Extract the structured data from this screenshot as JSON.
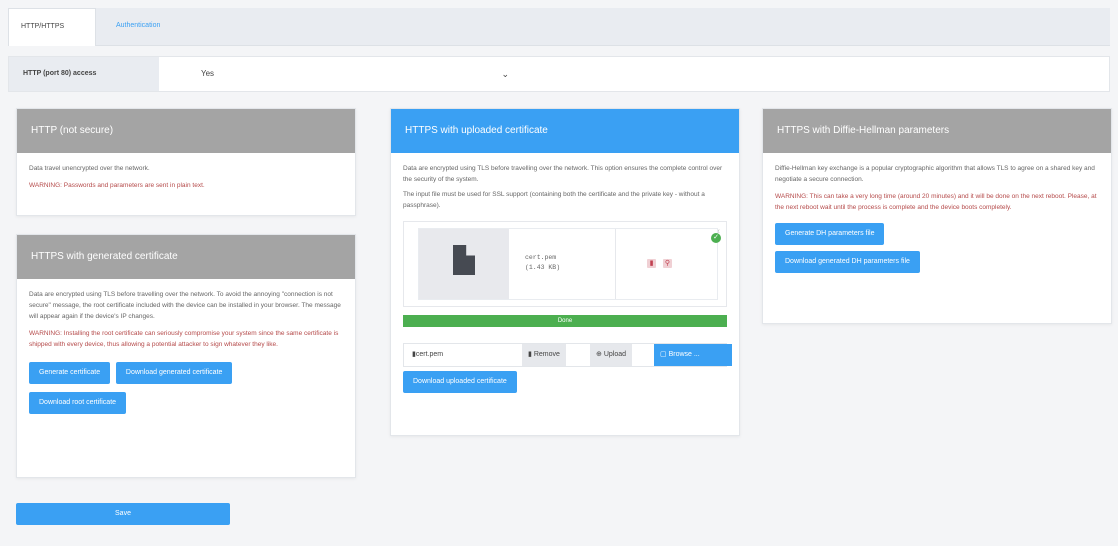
{
  "tabs": [
    {
      "label": "HTTP/HTTPS"
    },
    {
      "label": "Authentication"
    }
  ],
  "access": {
    "label": "HTTP (port 80) access",
    "value": "Yes"
  },
  "panel_http": {
    "title": "HTTP (not secure)",
    "text": "Data travel unencrypted over the network.",
    "warning": "WARNING: Passwords and parameters are sent in plain text."
  },
  "panel_generated": {
    "title": "HTTPS with generated certificate",
    "text": "Data are encrypted using TLS before travelling over the network. To avoid the annoying \"connection is not secure\" message, the root certificate included with the device can be installed in your browser. The message will appear again if the device's IP changes.",
    "warning": "WARNING: Installing the root certificate can seriously compromise your system since the same certificate is shipped with every device, thus allowing a potential attacker to sign whatever they like.",
    "btn_generate": "Generate certificate",
    "btn_download_generated": "Download generated certificate",
    "btn_download_root": "Download root certificate"
  },
  "panel_uploaded": {
    "title": "HTTPS with uploaded certificate",
    "text1": "Data are encrypted using TLS before travelling over the network. This option ensures the complete control over the security of the system.",
    "text2": "The input file must be used for SSL support (containing both the certificate and the private key - without a passphrase).",
    "file_name": "cert.pem",
    "file_size": "(1.43 KB)",
    "progress_label": "Done",
    "progress_fraction": 1.0,
    "upload_filename": "cert.pem",
    "btn_remove": "Remove",
    "btn_upload": "Upload",
    "btn_browse": "Browse ...",
    "btn_download_uploaded": "Download uploaded certificate"
  },
  "panel_dh": {
    "title": "HTTPS with Diffie-Hellman parameters",
    "text": "Diffie-Hellman key exchange is a popular cryptographic algorithm that allows TLS to agree on a shared key and negotiate a secure connection.",
    "warning": "WARNING: This can take a very long time (around 20 minutes) and it will be done on the next reboot. Please, at the next reboot wait until the process is complete and the device boots completely.",
    "btn_generate_dh": "Generate DH parameters file",
    "btn_download_dh": "Download generated DH parameters file"
  },
  "save_label": "Save",
  "colors": {
    "accent": "#3aa0f3",
    "header_gray": "#a4a4a4",
    "warning": "#b54a4a",
    "success": "#4caf50"
  }
}
